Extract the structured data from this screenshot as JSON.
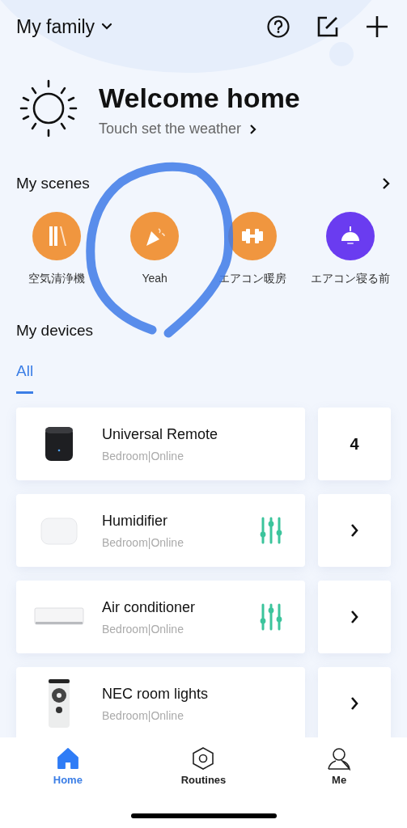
{
  "header": {
    "home_name": "My family"
  },
  "weather": {
    "title": "Welcome home",
    "hint": "Touch set the weather"
  },
  "scenes": {
    "title": "My scenes",
    "items": [
      {
        "label": "空気清浄機",
        "color": "#f0963f"
      },
      {
        "label": "Yeah",
        "color": "#f0963f"
      },
      {
        "label": "エアコン暖房",
        "color": "#f0963f"
      },
      {
        "label": "エアコン寝る前",
        "color": "#6a3cf0"
      }
    ]
  },
  "devices": {
    "title": "My devices",
    "tabs": [
      {
        "label": "All",
        "selected": true
      }
    ],
    "items": [
      {
        "name": "Universal Remote",
        "status": "Bedroom|Online",
        "controls": false,
        "kind": "count",
        "count": "4"
      },
      {
        "name": "Humidifier",
        "status": "Bedroom|Online",
        "controls": true,
        "kind": "arrow"
      },
      {
        "name": "Air conditioner",
        "status": "Bedroom|Online",
        "controls": true,
        "kind": "arrow"
      },
      {
        "name": "NEC room lights",
        "status": "Bedroom|Online",
        "controls": false,
        "kind": "arrow"
      }
    ]
  },
  "nav": [
    {
      "label": "Home",
      "selected": true
    },
    {
      "label": "Routines",
      "selected": false
    },
    {
      "label": "Me",
      "selected": false
    }
  ],
  "annotation": {
    "kind": "scribble"
  }
}
